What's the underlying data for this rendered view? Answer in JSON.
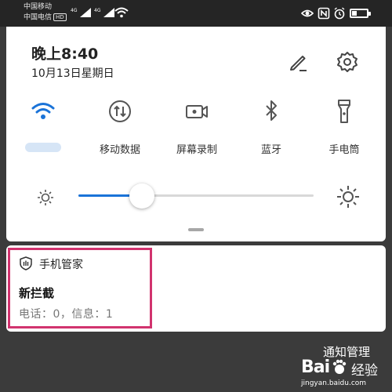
{
  "status_bar": {
    "carrier_1": "中国移动",
    "carrier_2": "中国电信",
    "carrier_2_badge": "HD",
    "network_label_1": "4G",
    "network_label_2": "4G",
    "battery_level_fraction": 0.35,
    "icons": [
      "eye-comfort-icon",
      "nfc-icon",
      "alarm-icon",
      "battery-icon",
      "wifi-status-icon",
      "signal-icon"
    ]
  },
  "panel": {
    "time": "晚上8:40",
    "date": "10月13日星期日",
    "actions": [
      "edit-icon",
      "settings-gear-icon"
    ],
    "tiles": [
      {
        "label": "",
        "icon": "wifi-icon",
        "active": true,
        "label_obscured": true
      },
      {
        "label": "移动数据",
        "icon": "mobile-data-icon",
        "active": false
      },
      {
        "label": "屏幕录制",
        "icon": "screen-record-icon",
        "active": false
      },
      {
        "label": "蓝牙",
        "icon": "bluetooth-icon",
        "active": false
      },
      {
        "label": "手电筒",
        "icon": "flashlight-icon",
        "active": false
      }
    ],
    "brightness": {
      "level_fraction": 0.27,
      "accent_color": "#1a73d8"
    }
  },
  "notification": {
    "app_name": "手机管家",
    "title": "新拦截",
    "body": "电话：0，信息：1",
    "highlight_color": "#d1336e"
  },
  "footer": {
    "notification_management": "通知管理"
  },
  "watermark": {
    "logo": "Bai",
    "logo_suffix": "经验",
    "url": "jingyan.baidu.com"
  }
}
